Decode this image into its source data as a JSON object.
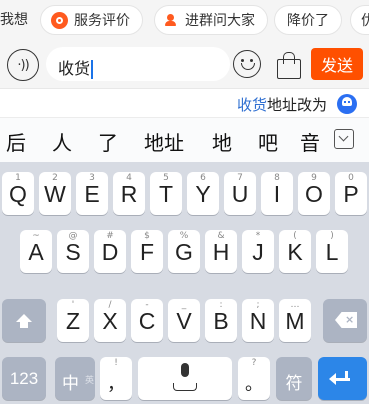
{
  "quick_replies": {
    "first_fragment": "我想",
    "chips": [
      {
        "label": "服务评价",
        "icon": "smile-circle-icon"
      },
      {
        "label": "进群问大家",
        "icon": "person-icon"
      },
      {
        "label": "降价了",
        "icon": ""
      },
      {
        "label": "优",
        "icon": ""
      }
    ]
  },
  "input_bar": {
    "voice_icon_glyph": "·))",
    "text": "收货",
    "send_label": "发送",
    "accent_color": "#ff5000"
  },
  "suggestion": {
    "highlight": "收货",
    "rest": "地址改为",
    "icon": "assistant-bot-icon"
  },
  "candidates": [
    "后",
    "人",
    "了",
    "地址",
    "地",
    "吧",
    "音"
  ],
  "keyboard": {
    "row1": [
      {
        "letter": "Q",
        "hint": "1"
      },
      {
        "letter": "W",
        "hint": "2"
      },
      {
        "letter": "E",
        "hint": "3"
      },
      {
        "letter": "R",
        "hint": "4"
      },
      {
        "letter": "T",
        "hint": "5"
      },
      {
        "letter": "Y",
        "hint": "6"
      },
      {
        "letter": "U",
        "hint": "7"
      },
      {
        "letter": "I",
        "hint": "8"
      },
      {
        "letter": "O",
        "hint": "9"
      },
      {
        "letter": "P",
        "hint": "0"
      }
    ],
    "row2": [
      {
        "letter": "A",
        "hint": "~"
      },
      {
        "letter": "S",
        "hint": "@"
      },
      {
        "letter": "D",
        "hint": "#"
      },
      {
        "letter": "F",
        "hint": "$"
      },
      {
        "letter": "G",
        "hint": "%"
      },
      {
        "letter": "H",
        "hint": "&"
      },
      {
        "letter": "J",
        "hint": "*"
      },
      {
        "letter": "K",
        "hint": "("
      },
      {
        "letter": "L",
        "hint": ")"
      }
    ],
    "row3": [
      {
        "letter": "Z",
        "hint": "'"
      },
      {
        "letter": "X",
        "hint": "/"
      },
      {
        "letter": "C",
        "hint": "-"
      },
      {
        "letter": "V",
        "hint": "_"
      },
      {
        "letter": "B",
        "hint": ":"
      },
      {
        "letter": "N",
        "hint": ";"
      },
      {
        "letter": "M",
        "hint": "…"
      }
    ],
    "row4": {
      "numbers_label": "123",
      "lang_label": "中",
      "lang_sub": "英",
      "comma_label": "，",
      "comma_hint": "!",
      "period_label": "。",
      "period_hint": "?",
      "symbol_label": "符"
    },
    "enter_color": "#2c86e8"
  }
}
